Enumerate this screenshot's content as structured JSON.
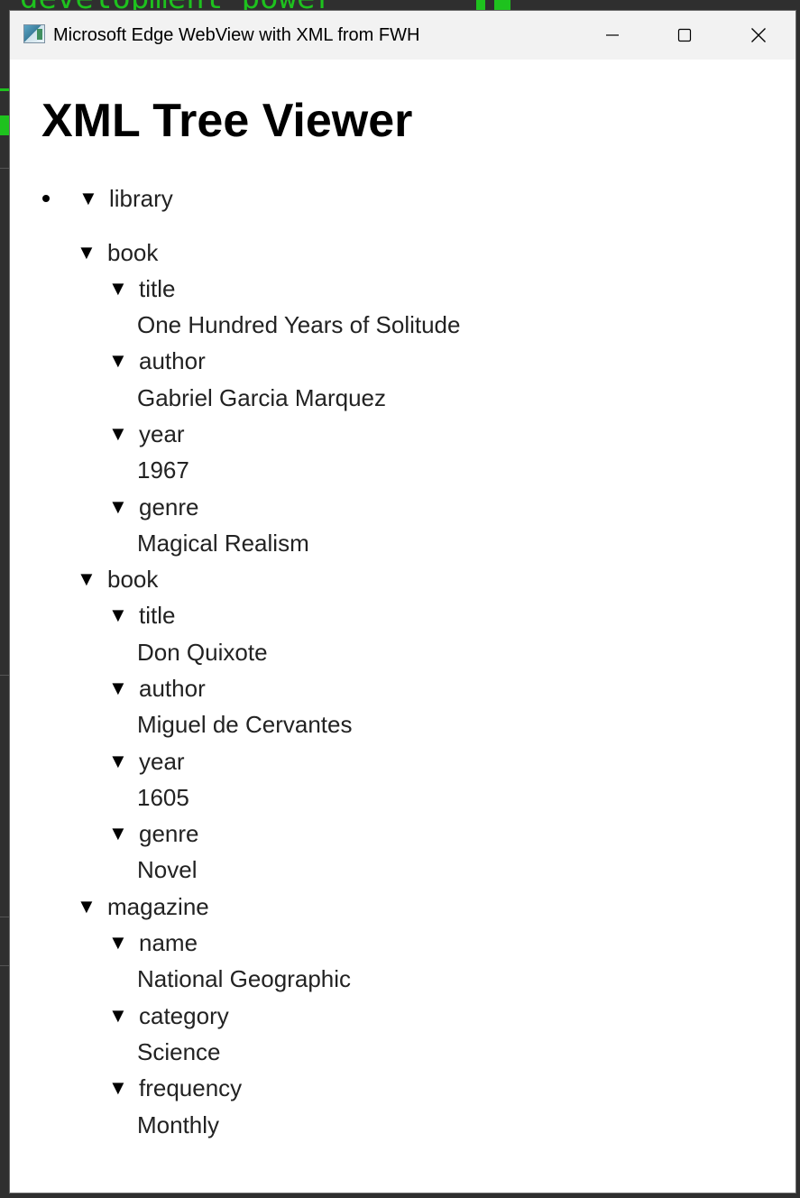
{
  "window": {
    "title": "Microsoft Edge WebView with XML from FWH"
  },
  "background": {
    "terminal_text": "development power"
  },
  "page": {
    "title": "XML Tree Viewer"
  },
  "tree": {
    "root": "library",
    "book1": {
      "tag": "book",
      "title_tag": "title",
      "title": "One Hundred Years of Solitude",
      "author_tag": "author",
      "author": "Gabriel Garcia Marquez",
      "year_tag": "year",
      "year": "1967",
      "genre_tag": "genre",
      "genre": "Magical Realism"
    },
    "book2": {
      "tag": "book",
      "title_tag": "title",
      "title": "Don Quixote",
      "author_tag": "author",
      "author": "Miguel de Cervantes",
      "year_tag": "year",
      "year": "1605",
      "genre_tag": "genre",
      "genre": "Novel"
    },
    "magazine": {
      "tag": "magazine",
      "name_tag": "name",
      "name": "National Geographic",
      "category_tag": "category",
      "category": "Science",
      "frequency_tag": "frequency",
      "frequency": "Monthly"
    },
    "toggle_glyph": "▼"
  },
  "icons": {
    "app": "app-window-icon",
    "minimize": "minimize-icon",
    "maximize": "maximize-icon",
    "close": "close-icon",
    "expand": "triangle-down-icon"
  }
}
